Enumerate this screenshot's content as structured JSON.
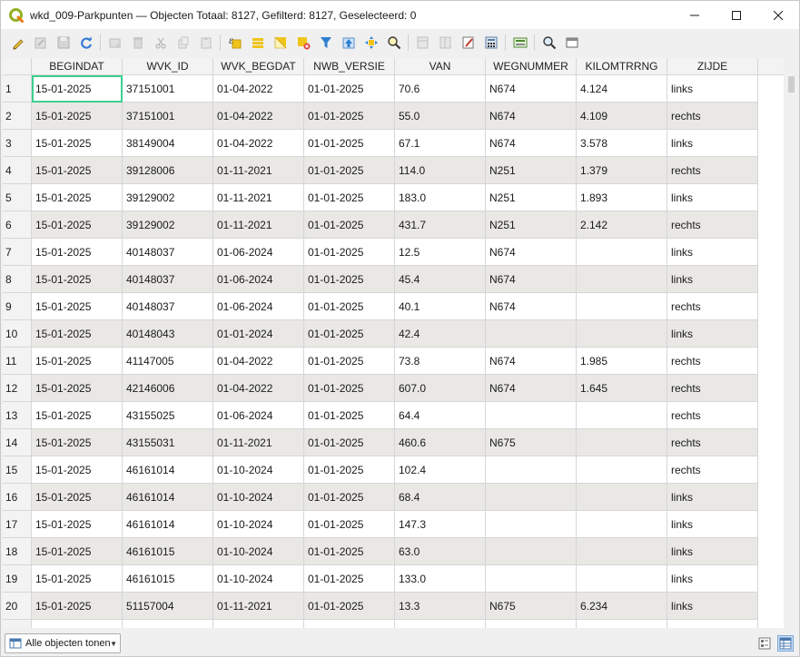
{
  "window": {
    "title": "wkd_009-Parkpunten — Objecten Totaal: 8127, Gefilterd: 8127, Geselecteerd: 0"
  },
  "toolbar": {
    "icons": [
      "pencil-icon",
      "edit-multiple-icon",
      "save-icon",
      "reload-icon",
      "add-feature-icon",
      "delete-icon",
      "cut-icon",
      "copy-icon",
      "paste-icon",
      "select-by-expression-icon",
      "select-all-icon",
      "invert-selection-icon",
      "deselect-icon",
      "filter-icon",
      "move-selection-top-icon",
      "pan-to-selection-icon",
      "zoom-to-selection-icon",
      "new-field-icon",
      "delete-field-icon",
      "conditional-formatting-icon",
      "field-calculator-icon",
      "organize-columns-icon",
      "dock-icon",
      "actions-icon"
    ]
  },
  "table": {
    "columns": [
      "BEGINDAT",
      "WVK_ID",
      "WVK_BEGDAT",
      "NWB_VERSIE",
      "VAN",
      "WEGNUMMER",
      "KILOMTRRNG",
      "ZIJDE"
    ],
    "rows": [
      {
        "n": "1",
        "c": [
          "15-01-2025",
          "37151001",
          "01-04-2022",
          "01-01-2025",
          "70.6",
          "N674",
          "4.124",
          "links"
        ]
      },
      {
        "n": "2",
        "c": [
          "15-01-2025",
          "37151001",
          "01-04-2022",
          "01-01-2025",
          "55.0",
          "N674",
          "4.109",
          "rechts"
        ]
      },
      {
        "n": "3",
        "c": [
          "15-01-2025",
          "38149004",
          "01-04-2022",
          "01-01-2025",
          "67.1",
          "N674",
          "3.578",
          "links"
        ]
      },
      {
        "n": "4",
        "c": [
          "15-01-2025",
          "39128006",
          "01-11-2021",
          "01-01-2025",
          "114.0",
          "N251",
          "1.379",
          "rechts"
        ]
      },
      {
        "n": "5",
        "c": [
          "15-01-2025",
          "39129002",
          "01-11-2021",
          "01-01-2025",
          "183.0",
          "N251",
          "1.893",
          "links"
        ]
      },
      {
        "n": "6",
        "c": [
          "15-01-2025",
          "39129002",
          "01-11-2021",
          "01-01-2025",
          "431.7",
          "N251",
          "2.142",
          "rechts"
        ]
      },
      {
        "n": "7",
        "c": [
          "15-01-2025",
          "40148037",
          "01-06-2024",
          "01-01-2025",
          "12.5",
          "N674",
          "",
          "links"
        ]
      },
      {
        "n": "8",
        "c": [
          "15-01-2025",
          "40148037",
          "01-06-2024",
          "01-01-2025",
          "45.4",
          "N674",
          "",
          "links"
        ]
      },
      {
        "n": "9",
        "c": [
          "15-01-2025",
          "40148037",
          "01-06-2024",
          "01-01-2025",
          "40.1",
          "N674",
          "",
          "rechts"
        ]
      },
      {
        "n": "10",
        "c": [
          "15-01-2025",
          "40148043",
          "01-01-2024",
          "01-01-2025",
          "42.4",
          "",
          "",
          "links"
        ]
      },
      {
        "n": "11",
        "c": [
          "15-01-2025",
          "41147005",
          "01-04-2022",
          "01-01-2025",
          "73.8",
          "N674",
          "1.985",
          "rechts"
        ]
      },
      {
        "n": "12",
        "c": [
          "15-01-2025",
          "42146006",
          "01-04-2022",
          "01-01-2025",
          "607.0",
          "N674",
          "1.645",
          "rechts"
        ]
      },
      {
        "n": "13",
        "c": [
          "15-01-2025",
          "43155025",
          "01-06-2024",
          "01-01-2025",
          "64.4",
          "",
          "",
          "rechts"
        ]
      },
      {
        "n": "14",
        "c": [
          "15-01-2025",
          "43155031",
          "01-11-2021",
          "01-01-2025",
          "460.6",
          "N675",
          "",
          "rechts"
        ]
      },
      {
        "n": "15",
        "c": [
          "15-01-2025",
          "46161014",
          "01-10-2024",
          "01-01-2025",
          "102.4",
          "",
          "",
          "rechts"
        ]
      },
      {
        "n": "16",
        "c": [
          "15-01-2025",
          "46161014",
          "01-10-2024",
          "01-01-2025",
          "68.4",
          "",
          "",
          "links"
        ]
      },
      {
        "n": "17",
        "c": [
          "15-01-2025",
          "46161014",
          "01-10-2024",
          "01-01-2025",
          "147.3",
          "",
          "",
          "links"
        ]
      },
      {
        "n": "18",
        "c": [
          "15-01-2025",
          "46161015",
          "01-10-2024",
          "01-01-2025",
          "63.0",
          "",
          "",
          "links"
        ]
      },
      {
        "n": "19",
        "c": [
          "15-01-2025",
          "46161015",
          "01-10-2024",
          "01-01-2025",
          "133.0",
          "",
          "",
          "links"
        ]
      },
      {
        "n": "20",
        "c": [
          "15-01-2025",
          "51157004",
          "01-11-2021",
          "01-01-2025",
          "13.3",
          "N675",
          "6.234",
          "links"
        ]
      },
      {
        "n": "",
        "c": [
          "",
          "",
          "",
          "",
          "",
          "",
          "",
          ""
        ]
      }
    ]
  },
  "bottom": {
    "filter_label": "Alle objecten tonen"
  },
  "colors": {
    "accent_focus": "#3ccf8e",
    "row_alt": "#e9e8e4",
    "qgis_green": "#93b023"
  }
}
